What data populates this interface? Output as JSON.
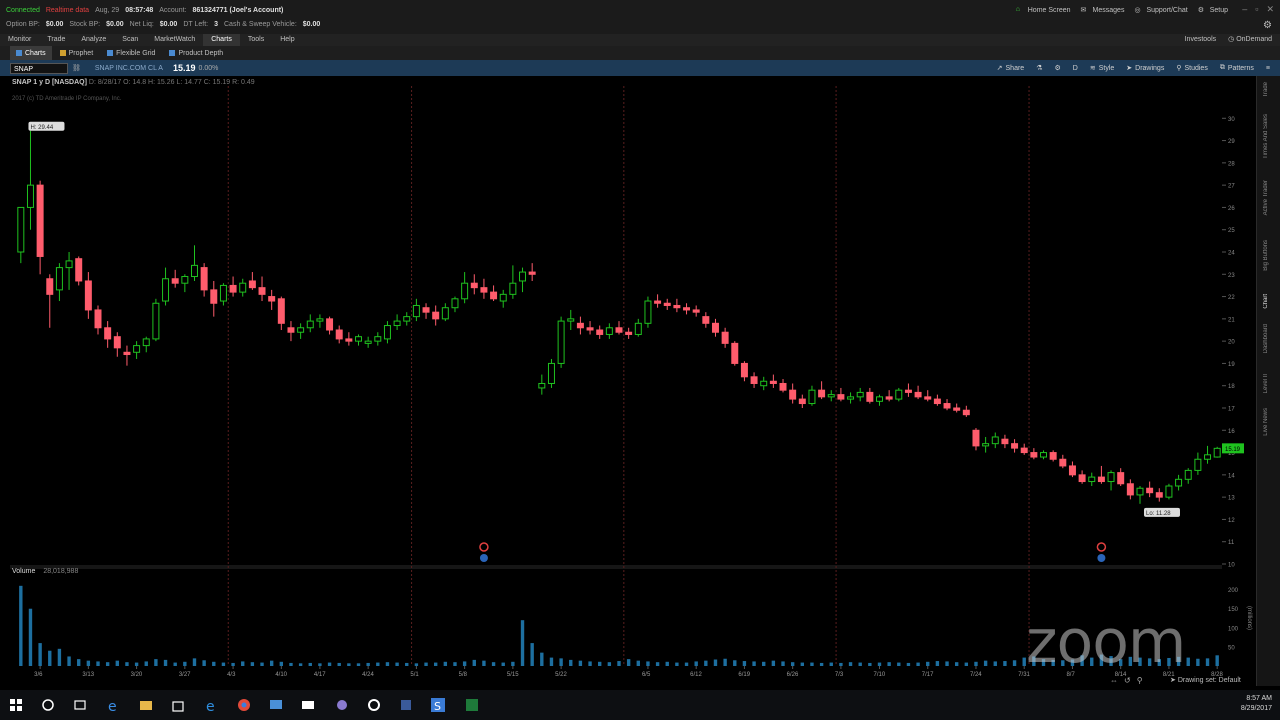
{
  "status": {
    "connected": "Connected",
    "realtime": "Realtime data",
    "date": "Aug, 29",
    "time": "08:57:48",
    "account_label": "Account:",
    "account_value": "861324771 (Joel's Account)",
    "option_bp_label": "Option BP:",
    "option_bp": "$0.00",
    "stock_bp_label": "Stock BP:",
    "stock_bp": "$0.00",
    "net_liq_label": "Net Liq:",
    "net_liq": "$0.00",
    "dt_left_label": "DT Left:",
    "dt_left": "3",
    "cash_label": "Cash & Sweep Vehicle:",
    "cash": "$0.00"
  },
  "top_links": [
    "Home Screen",
    "Messages",
    "Support/Chat",
    "Setup"
  ],
  "menu": {
    "items": [
      "Monitor",
      "Trade",
      "Analyze",
      "Scan",
      "MarketWatch",
      "Charts",
      "Tools",
      "Help"
    ],
    "active": "Charts",
    "right": [
      "Investools",
      "OnDemand"
    ]
  },
  "subtabs": [
    "Charts",
    "Prophet",
    "Flexible Grid",
    "Product Depth"
  ],
  "chart_header": {
    "symbol": "SNAP",
    "company": "SNAP INC.COM CL A",
    "price": "15.19",
    "change": "0.00%",
    "tools": [
      "Share",
      "Style",
      "Drawings",
      "Studies",
      "Patterns"
    ],
    "tool_d": "D"
  },
  "chart_info": {
    "title": "SNAP 1 y D [NASDAQ]",
    "ohlc": "D: 8/28/17  O: 14.8  H: 15.26  L: 14.77  C: 15.19  R: 0.49",
    "copyright": "2017 (c) TD Ameritrade IP Company, Inc."
  },
  "volume_panel": {
    "label": "Volume",
    "value": "28,018,988",
    "unit_label": "(millions)"
  },
  "sidebar_tabs": [
    "Trade",
    "Times And Sales",
    "Active Trader",
    "Big Buttons",
    "Chart",
    "Dashboard",
    "Level II",
    "Live News"
  ],
  "footer": {
    "drawing_set": "Drawing set: Default"
  },
  "taskbar": {
    "time": "8:57 AM",
    "date": "8/29/2017"
  },
  "watermark": "zoom",
  "colors": {
    "up": "#1fc21f",
    "down": "#ff5c6c",
    "volume": "#1d6fa0",
    "grid_vline": "#5a1e1e",
    "header_blue": "#1d3a56"
  },
  "chart_data": {
    "type": "candlestick",
    "ylim": [
      10,
      31
    ],
    "y_ticks": [
      10,
      11,
      12,
      13,
      14,
      15,
      16,
      17,
      18,
      19,
      20,
      21,
      22,
      23,
      24,
      25,
      26,
      27,
      28,
      29,
      30
    ],
    "x_ticks": [
      "3/6",
      "3/13",
      "3/20",
      "3/27",
      "4/3",
      "4/10",
      "4/17",
      "4/24",
      "5/1",
      "5/8",
      "5/15",
      "5/22",
      "5/29",
      "6/5",
      "6/12",
      "6/19",
      "6/26",
      "7/3",
      "7/10",
      "7/17",
      "7/24",
      "7/31",
      "8/7",
      "8/14",
      "8/21",
      "8/28"
    ],
    "month_lines": [
      "4/1",
      "5/1",
      "6/1",
      "7/1",
      "8/1"
    ],
    "high_label": "H: 29.44",
    "low_label": "Lo: 11.28",
    "last_price_label": "15.19",
    "earnings_markers": [
      "5/10",
      "8/10"
    ],
    "candles": [
      {
        "d": "3/2",
        "o": 24.0,
        "h": 26.0,
        "l": 23.5,
        "c": 26.0
      },
      {
        "d": "3/3",
        "o": 26.0,
        "h": 29.44,
        "l": 25.0,
        "c": 27.0
      },
      {
        "d": "3/6",
        "o": 27.0,
        "h": 27.2,
        "l": 23.0,
        "c": 23.8
      },
      {
        "d": "3/7",
        "o": 22.8,
        "h": 23.0,
        "l": 20.6,
        "c": 22.1
      },
      {
        "d": "3/8",
        "o": 22.3,
        "h": 23.5,
        "l": 21.8,
        "c": 23.3
      },
      {
        "d": "3/9",
        "o": 23.3,
        "h": 24.0,
        "l": 22.3,
        "c": 23.6
      },
      {
        "d": "3/10",
        "o": 23.7,
        "h": 23.8,
        "l": 22.5,
        "c": 22.7
      },
      {
        "d": "3/13",
        "o": 22.7,
        "h": 23.1,
        "l": 21.0,
        "c": 21.4
      },
      {
        "d": "3/14",
        "o": 21.4,
        "h": 21.6,
        "l": 20.3,
        "c": 20.6
      },
      {
        "d": "3/15",
        "o": 20.6,
        "h": 20.9,
        "l": 19.7,
        "c": 20.1
      },
      {
        "d": "3/16",
        "o": 20.2,
        "h": 20.4,
        "l": 19.3,
        "c": 19.7
      },
      {
        "d": "3/17",
        "o": 19.5,
        "h": 19.8,
        "l": 18.9,
        "c": 19.4
      },
      {
        "d": "3/20",
        "o": 19.5,
        "h": 20.0,
        "l": 19.2,
        "c": 19.8
      },
      {
        "d": "3/21",
        "o": 19.8,
        "h": 20.2,
        "l": 19.5,
        "c": 20.1
      },
      {
        "d": "3/22",
        "o": 20.1,
        "h": 21.9,
        "l": 20.0,
        "c": 21.7
      },
      {
        "d": "3/23",
        "o": 21.8,
        "h": 23.3,
        "l": 21.6,
        "c": 22.8
      },
      {
        "d": "3/24",
        "o": 22.8,
        "h": 23.2,
        "l": 22.4,
        "c": 22.6
      },
      {
        "d": "3/27",
        "o": 22.6,
        "h": 23.0,
        "l": 22.2,
        "c": 22.9
      },
      {
        "d": "3/28",
        "o": 22.9,
        "h": 24.3,
        "l": 22.7,
        "c": 23.4
      },
      {
        "d": "3/29",
        "o": 23.3,
        "h": 23.5,
        "l": 22.0,
        "c": 22.3
      },
      {
        "d": "3/30",
        "o": 22.3,
        "h": 22.7,
        "l": 21.1,
        "c": 21.7
      },
      {
        "d": "3/31",
        "o": 21.8,
        "h": 22.6,
        "l": 21.6,
        "c": 22.5
      },
      {
        "d": "4/3",
        "o": 22.5,
        "h": 22.9,
        "l": 22.0,
        "c": 22.2
      },
      {
        "d": "4/4",
        "o": 22.2,
        "h": 22.8,
        "l": 22.0,
        "c": 22.6
      },
      {
        "d": "4/5",
        "o": 22.7,
        "h": 23.1,
        "l": 22.3,
        "c": 22.4
      },
      {
        "d": "4/6",
        "o": 22.4,
        "h": 22.9,
        "l": 21.8,
        "c": 22.1
      },
      {
        "d": "4/7",
        "o": 22.0,
        "h": 22.3,
        "l": 21.4,
        "c": 21.8
      },
      {
        "d": "4/10",
        "o": 21.9,
        "h": 22.0,
        "l": 20.5,
        "c": 20.8
      },
      {
        "d": "4/11",
        "o": 20.6,
        "h": 20.9,
        "l": 20.0,
        "c": 20.4
      },
      {
        "d": "4/12",
        "o": 20.4,
        "h": 20.8,
        "l": 20.1,
        "c": 20.6
      },
      {
        "d": "4/13",
        "o": 20.6,
        "h": 21.2,
        "l": 20.4,
        "c": 20.9
      },
      {
        "d": "4/17",
        "o": 20.9,
        "h": 21.2,
        "l": 20.6,
        "c": 21.0
      },
      {
        "d": "4/18",
        "o": 21.0,
        "h": 21.1,
        "l": 20.3,
        "c": 20.5
      },
      {
        "d": "4/19",
        "o": 20.5,
        "h": 20.7,
        "l": 19.9,
        "c": 20.1
      },
      {
        "d": "4/20",
        "o": 20.1,
        "h": 20.4,
        "l": 19.8,
        "c": 20.0
      },
      {
        "d": "4/21",
        "o": 20.0,
        "h": 20.3,
        "l": 19.8,
        "c": 20.2
      },
      {
        "d": "4/24",
        "o": 19.9,
        "h": 20.2,
        "l": 19.7,
        "c": 20.0
      },
      {
        "d": "4/25",
        "o": 20.0,
        "h": 20.4,
        "l": 19.8,
        "c": 20.2
      },
      {
        "d": "4/26",
        "o": 20.1,
        "h": 20.9,
        "l": 19.9,
        "c": 20.7
      },
      {
        "d": "4/27",
        "o": 20.7,
        "h": 21.2,
        "l": 20.5,
        "c": 20.9
      },
      {
        "d": "4/28",
        "o": 20.9,
        "h": 21.3,
        "l": 20.7,
        "c": 21.1
      },
      {
        "d": "5/1",
        "o": 21.1,
        "h": 21.9,
        "l": 20.9,
        "c": 21.6
      },
      {
        "d": "5/2",
        "o": 21.5,
        "h": 21.7,
        "l": 21.0,
        "c": 21.3
      },
      {
        "d": "5/3",
        "o": 21.3,
        "h": 21.6,
        "l": 20.7,
        "c": 21.0
      },
      {
        "d": "5/4",
        "o": 21.0,
        "h": 21.7,
        "l": 20.9,
        "c": 21.5
      },
      {
        "d": "5/5",
        "o": 21.5,
        "h": 22.0,
        "l": 21.3,
        "c": 21.9
      },
      {
        "d": "5/8",
        "o": 21.9,
        "h": 23.1,
        "l": 21.7,
        "c": 22.6
      },
      {
        "d": "5/9",
        "o": 22.6,
        "h": 23.0,
        "l": 22.1,
        "c": 22.4
      },
      {
        "d": "5/10",
        "o": 22.4,
        "h": 22.8,
        "l": 21.9,
        "c": 22.2
      },
      {
        "d": "5/11",
        "o": 22.2,
        "h": 22.5,
        "l": 21.8,
        "c": 21.9
      },
      {
        "d": "5/12",
        "o": 21.8,
        "h": 22.3,
        "l": 21.5,
        "c": 22.1
      },
      {
        "d": "5/15",
        "o": 22.1,
        "h": 23.4,
        "l": 21.9,
        "c": 22.6
      },
      {
        "d": "5/16",
        "o": 22.7,
        "h": 23.3,
        "l": 22.2,
        "c": 23.1
      },
      {
        "d": "5/17",
        "o": 23.1,
        "h": 23.5,
        "l": 22.7,
        "c": 23.0
      },
      {
        "d": "5/18",
        "o": 17.9,
        "h": 18.5,
        "l": 17.6,
        "c": 18.1
      },
      {
        "d": "5/19",
        "o": 18.1,
        "h": 19.2,
        "l": 17.9,
        "c": 19.0
      },
      {
        "d": "5/22",
        "o": 19.0,
        "h": 21.1,
        "l": 18.8,
        "c": 20.9
      },
      {
        "d": "5/23",
        "o": 20.9,
        "h": 21.4,
        "l": 20.5,
        "c": 21.0
      },
      {
        "d": "5/24",
        "o": 20.8,
        "h": 21.1,
        "l": 20.3,
        "c": 20.6
      },
      {
        "d": "5/25",
        "o": 20.6,
        "h": 20.9,
        "l": 20.3,
        "c": 20.5
      },
      {
        "d": "5/26",
        "o": 20.5,
        "h": 20.7,
        "l": 20.1,
        "c": 20.3
      },
      {
        "d": "5/30",
        "o": 20.3,
        "h": 20.8,
        "l": 20.1,
        "c": 20.6
      },
      {
        "d": "5/31",
        "o": 20.6,
        "h": 20.9,
        "l": 20.3,
        "c": 20.4
      },
      {
        "d": "6/1",
        "o": 20.4,
        "h": 20.6,
        "l": 20.1,
        "c": 20.3
      },
      {
        "d": "6/2",
        "o": 20.3,
        "h": 21.0,
        "l": 20.2,
        "c": 20.8
      },
      {
        "d": "6/5",
        "o": 20.8,
        "h": 22.0,
        "l": 20.6,
        "c": 21.8
      },
      {
        "d": "6/6",
        "o": 21.8,
        "h": 22.1,
        "l": 21.5,
        "c": 21.7
      },
      {
        "d": "6/7",
        "o": 21.7,
        "h": 21.9,
        "l": 21.4,
        "c": 21.6
      },
      {
        "d": "6/8",
        "o": 21.6,
        "h": 21.9,
        "l": 21.3,
        "c": 21.5
      },
      {
        "d": "6/9",
        "o": 21.5,
        "h": 21.7,
        "l": 21.2,
        "c": 21.4
      },
      {
        "d": "6/12",
        "o": 21.4,
        "h": 21.6,
        "l": 21.1,
        "c": 21.3
      },
      {
        "d": "6/13",
        "o": 21.1,
        "h": 21.3,
        "l": 20.6,
        "c": 20.8
      },
      {
        "d": "6/14",
        "o": 20.8,
        "h": 21.0,
        "l": 20.2,
        "c": 20.4
      },
      {
        "d": "6/15",
        "o": 20.4,
        "h": 20.6,
        "l": 19.7,
        "c": 19.9
      },
      {
        "d": "6/16",
        "o": 19.9,
        "h": 20.0,
        "l": 18.9,
        "c": 19.0
      },
      {
        "d": "6/19",
        "o": 19.0,
        "h": 19.1,
        "l": 18.2,
        "c": 18.4
      },
      {
        "d": "6/20",
        "o": 18.4,
        "h": 18.6,
        "l": 17.9,
        "c": 18.1
      },
      {
        "d": "6/21",
        "o": 18.0,
        "h": 18.4,
        "l": 17.8,
        "c": 18.2
      },
      {
        "d": "6/22",
        "o": 18.2,
        "h": 18.5,
        "l": 17.9,
        "c": 18.1
      },
      {
        "d": "6/23",
        "o": 18.1,
        "h": 18.3,
        "l": 17.7,
        "c": 17.8
      },
      {
        "d": "6/26",
        "o": 17.8,
        "h": 18.1,
        "l": 17.2,
        "c": 17.4
      },
      {
        "d": "6/27",
        "o": 17.4,
        "h": 17.6,
        "l": 17.0,
        "c": 17.2
      },
      {
        "d": "6/28",
        "o": 17.2,
        "h": 18.0,
        "l": 17.1,
        "c": 17.8
      },
      {
        "d": "6/29",
        "o": 17.8,
        "h": 18.2,
        "l": 17.4,
        "c": 17.5
      },
      {
        "d": "6/30",
        "o": 17.5,
        "h": 17.8,
        "l": 17.3,
        "c": 17.6
      },
      {
        "d": "7/3",
        "o": 17.6,
        "h": 17.9,
        "l": 17.3,
        "c": 17.4
      },
      {
        "d": "7/5",
        "o": 17.4,
        "h": 17.7,
        "l": 17.2,
        "c": 17.5
      },
      {
        "d": "7/6",
        "o": 17.5,
        "h": 17.9,
        "l": 17.3,
        "c": 17.7
      },
      {
        "d": "7/7",
        "o": 17.7,
        "h": 17.9,
        "l": 17.2,
        "c": 17.3
      },
      {
        "d": "7/10",
        "o": 17.3,
        "h": 17.6,
        "l": 17.1,
        "c": 17.5
      },
      {
        "d": "7/11",
        "o": 17.5,
        "h": 17.8,
        "l": 17.3,
        "c": 17.4
      },
      {
        "d": "7/12",
        "o": 17.4,
        "h": 17.9,
        "l": 17.3,
        "c": 17.8
      },
      {
        "d": "7/13",
        "o": 17.8,
        "h": 18.1,
        "l": 17.5,
        "c": 17.7
      },
      {
        "d": "7/14",
        "o": 17.7,
        "h": 18.0,
        "l": 17.4,
        "c": 17.5
      },
      {
        "d": "7/17",
        "o": 17.5,
        "h": 17.8,
        "l": 17.3,
        "c": 17.4
      },
      {
        "d": "7/18",
        "o": 17.4,
        "h": 17.6,
        "l": 17.1,
        "c": 17.2
      },
      {
        "d": "7/19",
        "o": 17.2,
        "h": 17.4,
        "l": 16.9,
        "c": 17.0
      },
      {
        "d": "7/20",
        "o": 17.0,
        "h": 17.2,
        "l": 16.8,
        "c": 16.9
      },
      {
        "d": "7/21",
        "o": 16.9,
        "h": 17.1,
        "l": 16.6,
        "c": 16.7
      },
      {
        "d": "7/24",
        "o": 16.0,
        "h": 16.1,
        "l": 15.1,
        "c": 15.3
      },
      {
        "d": "7/25",
        "o": 15.3,
        "h": 15.7,
        "l": 15.0,
        "c": 15.4
      },
      {
        "d": "7/26",
        "o": 15.4,
        "h": 15.9,
        "l": 15.2,
        "c": 15.7
      },
      {
        "d": "7/27",
        "o": 15.6,
        "h": 15.8,
        "l": 15.2,
        "c": 15.4
      },
      {
        "d": "7/28",
        "o": 15.4,
        "h": 15.6,
        "l": 15.0,
        "c": 15.2
      },
      {
        "d": "7/31",
        "o": 15.2,
        "h": 15.4,
        "l": 14.9,
        "c": 15.0
      },
      {
        "d": "8/1",
        "o": 15.0,
        "h": 15.2,
        "l": 14.7,
        "c": 14.8
      },
      {
        "d": "8/2",
        "o": 14.8,
        "h": 15.1,
        "l": 14.7,
        "c": 15.0
      },
      {
        "d": "8/3",
        "o": 15.0,
        "h": 15.1,
        "l": 14.6,
        "c": 14.7
      },
      {
        "d": "8/4",
        "o": 14.7,
        "h": 14.9,
        "l": 14.3,
        "c": 14.4
      },
      {
        "d": "8/7",
        "o": 14.4,
        "h": 14.6,
        "l": 13.9,
        "c": 14.0
      },
      {
        "d": "8/8",
        "o": 14.0,
        "h": 14.2,
        "l": 13.6,
        "c": 13.7
      },
      {
        "d": "8/9",
        "o": 13.7,
        "h": 14.1,
        "l": 13.5,
        "c": 13.9
      },
      {
        "d": "8/10",
        "o": 13.9,
        "h": 14.4,
        "l": 13.6,
        "c": 13.7
      },
      {
        "d": "8/11",
        "o": 13.7,
        "h": 14.2,
        "l": 13.3,
        "c": 14.1
      },
      {
        "d": "8/14",
        "o": 14.1,
        "h": 14.3,
        "l": 13.5,
        "c": 13.6
      },
      {
        "d": "8/15",
        "o": 13.6,
        "h": 13.8,
        "l": 12.9,
        "c": 13.1
      },
      {
        "d": "8/16",
        "o": 13.1,
        "h": 13.5,
        "l": 12.7,
        "c": 13.4
      },
      {
        "d": "8/17",
        "o": 13.4,
        "h": 13.7,
        "l": 13.0,
        "c": 13.2
      },
      {
        "d": "8/18",
        "o": 13.2,
        "h": 13.4,
        "l": 12.8,
        "c": 13.0
      },
      {
        "d": "8/21",
        "o": 13.0,
        "h": 13.6,
        "l": 12.9,
        "c": 13.5
      },
      {
        "d": "8/22",
        "o": 13.5,
        "h": 14.0,
        "l": 13.3,
        "c": 13.8
      },
      {
        "d": "8/23",
        "o": 13.8,
        "h": 14.3,
        "l": 13.6,
        "c": 14.2
      },
      {
        "d": "8/24",
        "o": 14.2,
        "h": 15.0,
        "l": 14.0,
        "c": 14.7
      },
      {
        "d": "8/25",
        "o": 14.7,
        "h": 15.3,
        "l": 14.5,
        "c": 14.9
      },
      {
        "d": "8/28",
        "o": 14.8,
        "h": 15.26,
        "l": 14.77,
        "c": 15.19
      }
    ],
    "volume": {
      "unit": "millions",
      "ylim": [
        0,
        220
      ],
      "y_ticks": [
        50,
        100,
        150,
        200
      ],
      "values": [
        210,
        150,
        60,
        40,
        45,
        25,
        18,
        14,
        12,
        10,
        14,
        10,
        9,
        12,
        18,
        16,
        9,
        11,
        20,
        15,
        11,
        9,
        8,
        12,
        10,
        9,
        14,
        11,
        8,
        7,
        8,
        7,
        9,
        8,
        7,
        7,
        8,
        9,
        10,
        9,
        8,
        7,
        9,
        9,
        11,
        10,
        12,
        16,
        14,
        10,
        9,
        11,
        120,
        60,
        35,
        22,
        20,
        16,
        14,
        12,
        11,
        10,
        13,
        18,
        14,
        12,
        10,
        11,
        9,
        9,
        12,
        14,
        17,
        19,
        15,
        13,
        12,
        11,
        14,
        12,
        10,
        9,
        9,
        8,
        9,
        8,
        10,
        9,
        8,
        9,
        10,
        9,
        8,
        9,
        11,
        13,
        12,
        10,
        9,
        11,
        14,
        12,
        13,
        15,
        22,
        25,
        18,
        16,
        15,
        17,
        28,
        22,
        30,
        26,
        18,
        24,
        22,
        20,
        18,
        21,
        24,
        22,
        19,
        20,
        28
      ]
    }
  }
}
